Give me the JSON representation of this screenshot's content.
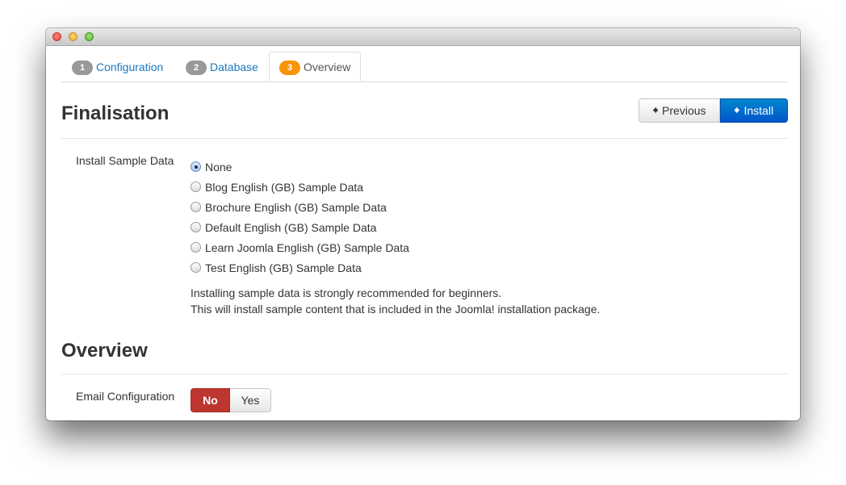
{
  "window": {
    "controls": [
      "close",
      "minimize",
      "zoom"
    ]
  },
  "tabs": [
    {
      "number": "1",
      "label": "Configuration",
      "active": false
    },
    {
      "number": "2",
      "label": "Database",
      "active": false
    },
    {
      "number": "3",
      "label": "Overview",
      "active": true
    }
  ],
  "finalisation": {
    "title": "Finalisation",
    "previous_label": "Previous",
    "install_label": "Install",
    "sample_data": {
      "label": "Install Sample Data",
      "options": [
        {
          "label": "None",
          "checked": true
        },
        {
          "label": "Blog English (GB) Sample Data",
          "checked": false
        },
        {
          "label": "Brochure English (GB) Sample Data",
          "checked": false
        },
        {
          "label": "Default English (GB) Sample Data",
          "checked": false
        },
        {
          "label": "Learn Joomla English (GB) Sample Data",
          "checked": false
        },
        {
          "label": "Test English (GB) Sample Data",
          "checked": false
        }
      ],
      "help_line1": "Installing sample data is strongly recommended for beginners.",
      "help_line2": "This will install sample content that is included in the Joomla! installation package."
    }
  },
  "overview": {
    "title": "Overview",
    "email_config": {
      "label": "Email Configuration",
      "no_label": "No",
      "yes_label": "Yes",
      "selected": "No"
    }
  },
  "colors": {
    "link": "#1a7ac0",
    "active_badge": "#f89406",
    "install_button": "#0066cc",
    "no_toggle": "#bd362f"
  }
}
